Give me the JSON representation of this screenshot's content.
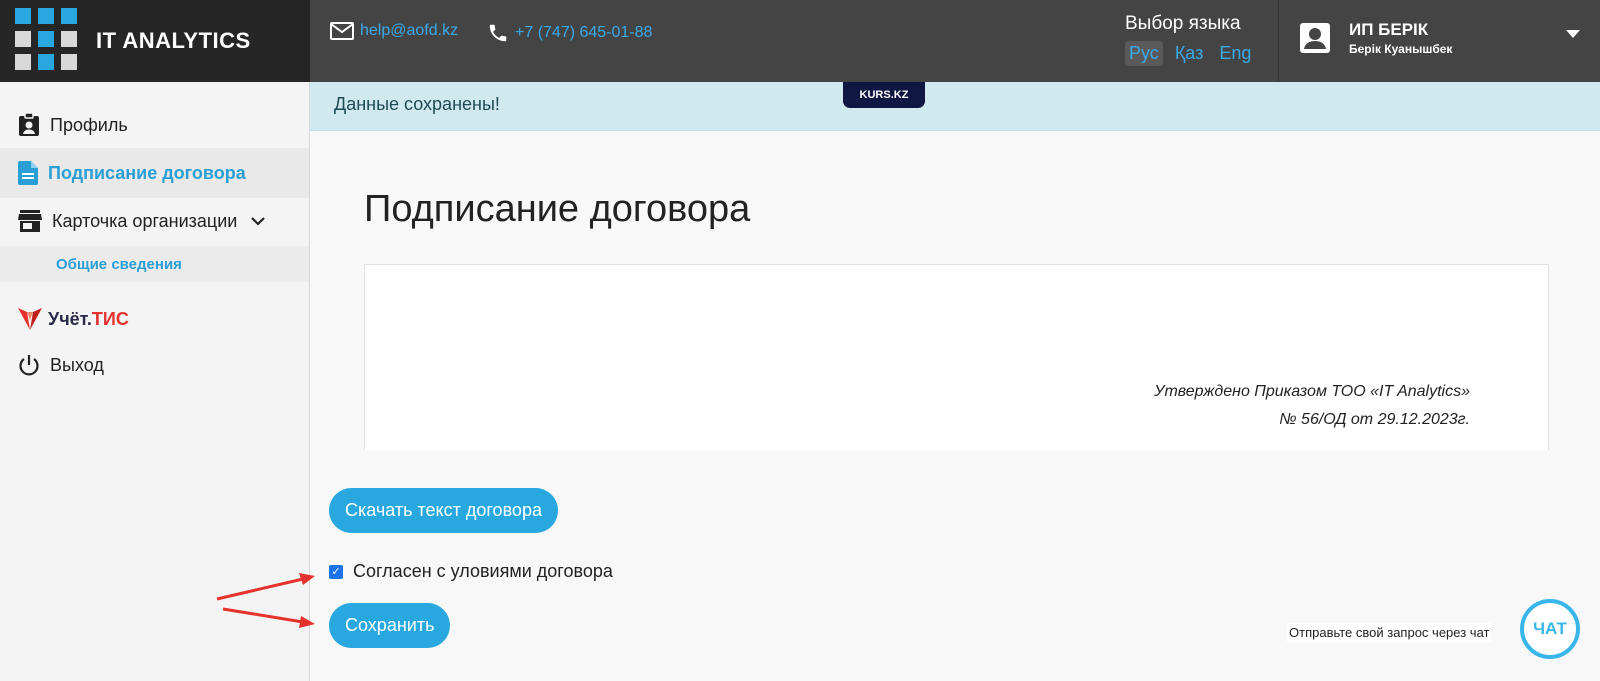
{
  "header": {
    "logo_text": "IT ANALYTICS",
    "email": "help@aofd.kz",
    "phone": "+7 (747) 645-01-88",
    "lang_title": "Выбор языка",
    "languages": [
      "Рус",
      "Қаз",
      "Eng"
    ],
    "active_language": "Рус",
    "user_name": "ИП БЕРІК",
    "user_sub": "Берік Куанышбек"
  },
  "sidebar": {
    "items": [
      {
        "label": "Профиль",
        "icon": "id-badge-icon"
      },
      {
        "label": "Подписание договора",
        "icon": "document-icon",
        "active": true
      },
      {
        "label": "Карточка организации",
        "icon": "store-icon",
        "expanded": true
      }
    ],
    "sub_item": "Общие сведения",
    "uchet_label": "Учёт.",
    "uchet_accent": "ТИС",
    "logout": "Выход"
  },
  "banner": {
    "message": "Данные сохранены!",
    "badge": "KURS.KZ"
  },
  "main": {
    "title": "Подписание договора",
    "doc_line1": "Утверждено Приказом ТОО «IT Analytics»",
    "doc_line2": "№ 56/ОД от 29.12.2023г.",
    "download_button": "Скачать текст договора",
    "agree_label": "Согласен с уловиями договора",
    "agree_checked": true,
    "save_button": "Сохранить"
  },
  "chat": {
    "prompt": "Отправьте свой запрос через чат",
    "button": "ЧАТ"
  },
  "colors": {
    "accent": "#29a8e0",
    "header_bg": "#444444",
    "logo_bg": "#262626",
    "banner_bg": "#d0e9ee",
    "arrow": "#e5322d"
  }
}
